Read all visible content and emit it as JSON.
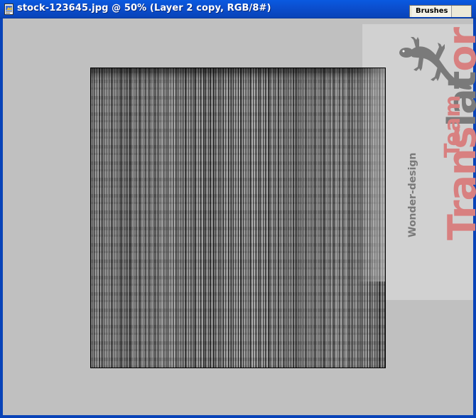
{
  "window": {
    "title": "stock-123645.jpg @ 50% (Layer 2 copy, RGB/8#)",
    "icon": "photoshop-document-icon",
    "titlebar_color": "#0b4fd0"
  },
  "palette_tab": {
    "label": "Brushes"
  },
  "watermark": {
    "logo_icon": "gecko-icon",
    "word_trans": "Trans",
    "word_lat": "lat",
    "word_or": "or",
    "subtitle": "Wonder-design",
    "team": "Team",
    "accent_color": "#d88080",
    "gray_color": "#7a7a7a"
  },
  "canvas": {
    "background_color": "#c0c0c0",
    "image_description_colors": [
      "#000000",
      "#ffffff",
      "#606060"
    ]
  }
}
